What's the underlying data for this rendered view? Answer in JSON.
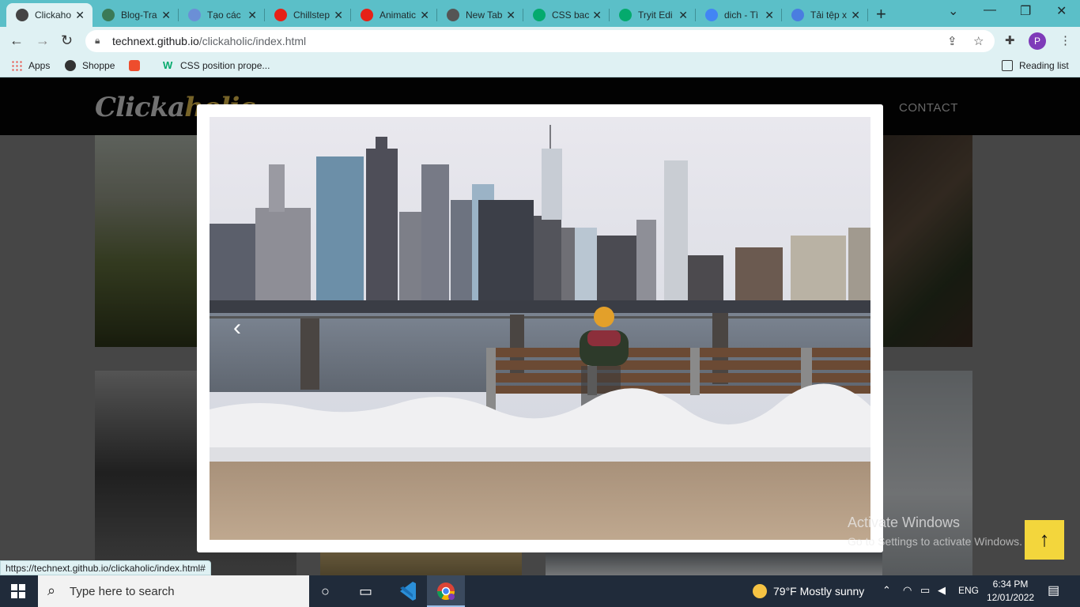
{
  "browser": {
    "tabs": [
      {
        "title": "Clickaho",
        "icon": "chrome-globe-icon",
        "color": "#444444",
        "active": true
      },
      {
        "title": "Blog-Tra",
        "icon": "earth-icon",
        "color": "#3b7a57"
      },
      {
        "title": "Tạo các",
        "icon": "v-logo-icon",
        "color": "#6b8fd6"
      },
      {
        "title": "Chillstep",
        "icon": "youtube-icon",
        "color": "#e62117"
      },
      {
        "title": "Animatic",
        "icon": "youtube-icon",
        "color": "#e62117"
      },
      {
        "title": "New Tab",
        "icon": "chrome-globe-icon",
        "color": "#555555"
      },
      {
        "title": "CSS bac",
        "icon": "w3schools-icon",
        "color": "#04aa6d"
      },
      {
        "title": "Tryit Edi",
        "icon": "w3schools-icon",
        "color": "#04aa6d"
      },
      {
        "title": "dich - Tì",
        "icon": "google-icon",
        "color": "#4285f4"
      },
      {
        "title": "Tải tệp x",
        "icon": "heart-icon",
        "color": "#4a7de0"
      }
    ],
    "address": {
      "host": "technext.github.io",
      "path": "/clickaholic/index.html"
    },
    "profile_initial": "P",
    "bookmarks": {
      "apps": "Apps",
      "shoppe": "Shoppe",
      "css": "CSS position prope...",
      "reading_list": "Reading list"
    }
  },
  "site": {
    "logo_main": "Clicka",
    "logo_accent": "holic",
    "nav_contact": "CONTACT"
  },
  "lightbox": {
    "prev_arrow": "‹",
    "scroll_top": "↑"
  },
  "status_url": "https://technext.github.io/clickaholic/index.html#",
  "watermark": {
    "title": "Activate Windows",
    "subtitle": "Go to Settings to activate Windows."
  },
  "taskbar": {
    "search_placeholder": "Type here to search",
    "weather": "79°F  Mostly sunny",
    "language": "ENG",
    "time": "6:34 PM",
    "date": "12/01/2022"
  }
}
